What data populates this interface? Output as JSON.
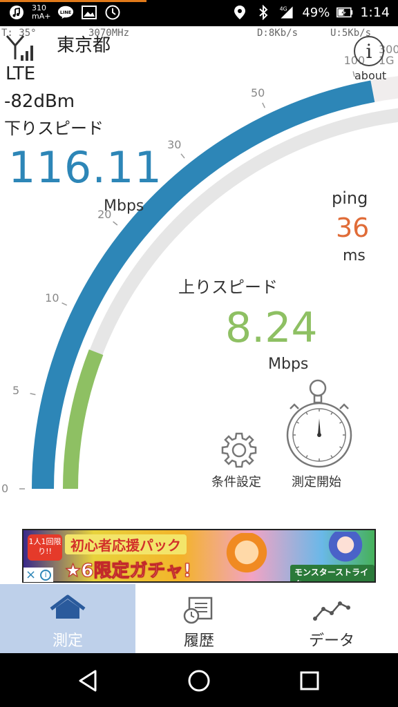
{
  "status_bar": {
    "data_usage_top": "310",
    "data_usage_bottom": "mA+",
    "line_icon_label": "LINE",
    "battery": "49%",
    "network_type": "4G",
    "time": "1:14",
    "icons": [
      "music-icon",
      "line-icon",
      "image-icon",
      "clock-icon",
      "location-icon",
      "bluetooth-icon",
      "signal-icon",
      "battery-icon"
    ]
  },
  "info_line": {
    "temp": "T: 35°",
    "freq": "3070MHz",
    "download_rate": "D:8Kb/s",
    "upload_rate": "U:5Kb/s"
  },
  "connection": {
    "region": "東京都",
    "network": "LTE",
    "signal": "-82dBm"
  },
  "about": {
    "icon": "i",
    "label": "about"
  },
  "download": {
    "label": "下りスピード",
    "value": "116.11",
    "unit": "Mbps"
  },
  "upload": {
    "label": "上りスピード",
    "value": "8.24",
    "unit": "Mbps"
  },
  "ping": {
    "label": "ping",
    "value": "36",
    "unit": "ms"
  },
  "gauge": {
    "ticks": [
      "0",
      "5",
      "10",
      "20",
      "30",
      "50",
      "100",
      "300",
      "1G"
    ],
    "download_color": "#2d86b7",
    "upload_color": "#8ec063",
    "track_color": "#e6e6e6",
    "download_level_ticks": 6.16,
    "upload_level_ticks": 1.65
  },
  "actions": {
    "settings_label": "条件設定",
    "start_label": "測定開始"
  },
  "ad": {
    "badge": "1人1回限り!!",
    "line1": "初心者応援パック",
    "line2": "★6限定ガチャ!",
    "line3": "モンスターストライク",
    "close_icon": "×",
    "info_icon": "i"
  },
  "tabs": [
    {
      "label": "測定",
      "icon": "home-icon",
      "active": true
    },
    {
      "label": "履歴",
      "icon": "history-icon",
      "active": false
    },
    {
      "label": "データ",
      "icon": "chart-line-icon",
      "active": false
    }
  ],
  "nav": [
    "back-icon",
    "home-circle-icon",
    "recents-icon"
  ]
}
